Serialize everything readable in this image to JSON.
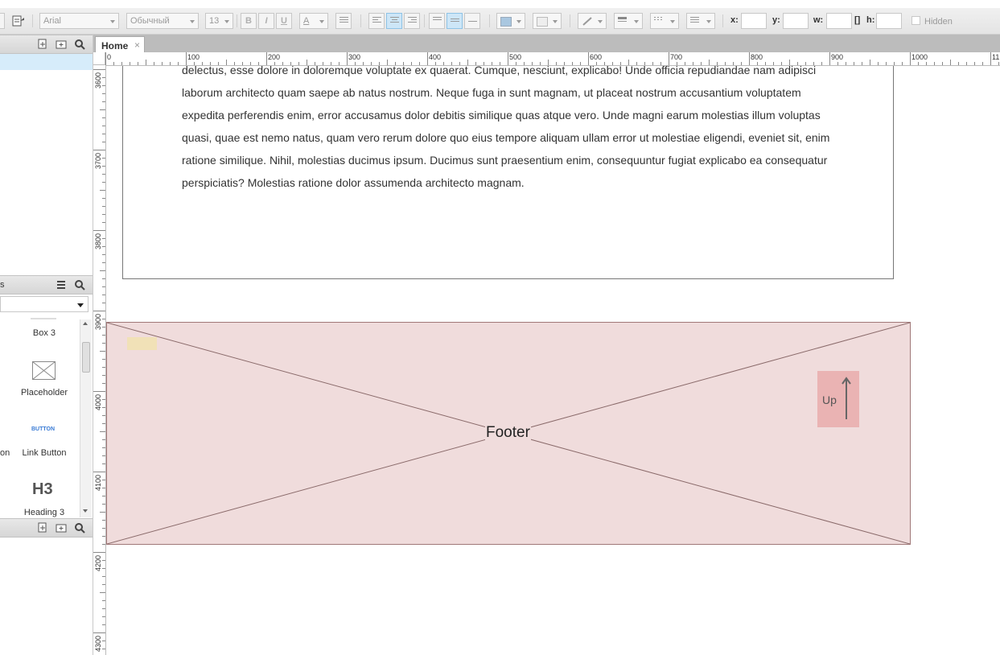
{
  "toolbar": {
    "font_family": "Arial",
    "font_style": "Обычный",
    "font_size": "13",
    "bold_label": "B",
    "italic_label": "I",
    "underline_label": "U",
    "font_color_label": "A",
    "x_label": "x:",
    "y_label": "y:",
    "w_label": "w:",
    "h_label": "h:",
    "x_value": "",
    "y_value": "",
    "w_value": "",
    "h_value": "",
    "hidden_label": "Hidden"
  },
  "tabs": [
    {
      "label": "Home",
      "close": "×"
    }
  ],
  "rulers": {
    "horizontal": [
      "0",
      "100",
      "200",
      "300",
      "400",
      "500",
      "600",
      "700",
      "800",
      "900",
      "1000",
      "11"
    ],
    "vertical": [
      "3600",
      "3700",
      "3800",
      "3900",
      "4000",
      "4100",
      "4200",
      "4300"
    ]
  },
  "left_panel": {
    "libraries_title_fragment": "s",
    "library_select_value": "",
    "widgets": [
      {
        "label": "Box 3",
        "icon": "box-icon"
      },
      {
        "label": "Placeholder",
        "icon": "placeholder-icon"
      },
      {
        "label": "Link Button",
        "icon": "link-button-icon",
        "preview_text": "BUTTON"
      },
      {
        "label": "Heading 3",
        "icon": "heading-icon",
        "preview_text": "H3"
      }
    ],
    "cut_off_left_label": "on"
  },
  "canvas": {
    "body_text_lines": [
      "delectus, esse dolore in doloremque voluptate ex quaerat. Cumque, nesciunt, explicabo! Unde officia repudiandae nam adipisci",
      "laborum architecto quam saepe ab natus nostrum. Neque fuga in sunt magnam, ut placeat nostrum accusantium voluptatem",
      "expedita perferendis enim, error accusamus dolor debitis similique quas atque vero. Unde magni earum molestias illum voluptas",
      "quasi, quae est nemo natus, quam vero rerum dolore quo eius tempore aliquam ullam error ut molestiae eligendi, eveniet sit, enim",
      "ratione similique. Nihil, molestias ducimus ipsum. Ducimus sunt praesentium enim, consequuntur fugiat explicabo ea consequatur",
      "perspiciatis? Molestias ratione dolor assumenda architecto magnam."
    ],
    "footer_label": "Footer",
    "up_label": "Up"
  },
  "colors": {
    "selection_row": "#d6ecfa",
    "footer_fill": "#f0dcdc",
    "footer_border": "#a07878",
    "up_box": "#eab3b3",
    "yellow_note": "#f1e1b7"
  }
}
